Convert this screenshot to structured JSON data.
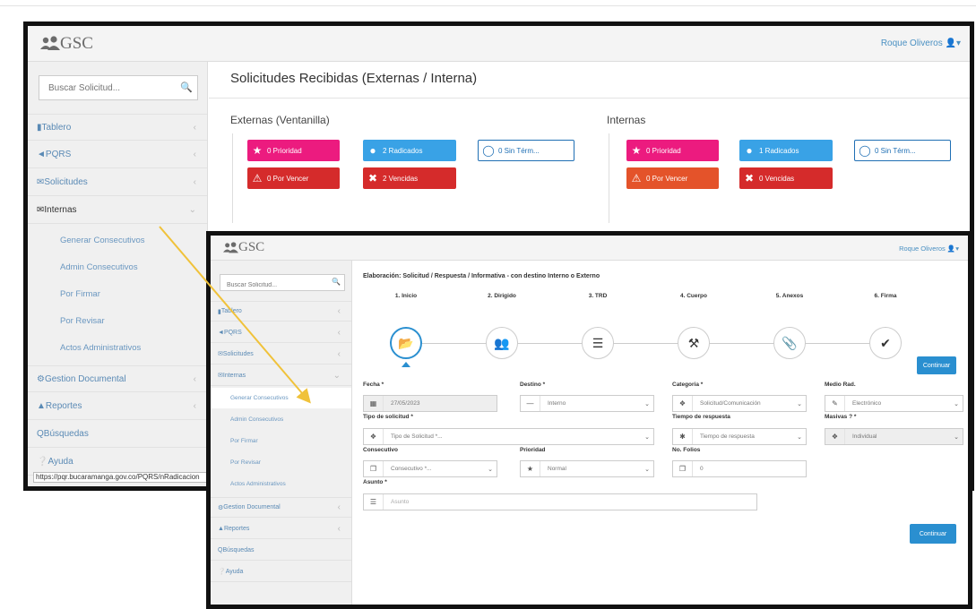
{
  "back_window": {
    "brand": "GSC",
    "user": "Roque Oliveros",
    "search_placeholder": "Buscar Solicitud...",
    "nav": [
      {
        "label": "Tablero"
      },
      {
        "label": "PQRS"
      },
      {
        "label": "Solicitudes"
      },
      {
        "label": "Internas"
      }
    ],
    "subnav": [
      "Generar Consecutivos",
      "Admin Consecutivos",
      "Por Firmar",
      "Por Revisar",
      "Actos Administrativos"
    ],
    "nav_bottom": [
      {
        "label": "Gestion Documental"
      },
      {
        "label": "Reportes"
      },
      {
        "label": "Búsquedas"
      },
      {
        "label": "Ayuda"
      }
    ],
    "status_url": "https://pqr.bucaramanga.gov.co/PQRS/nRadicacion",
    "page_title": "Solicitudes Recibidas (Externas / Interna)",
    "externas": {
      "title": "Externas (Ventanilla)",
      "tiles": {
        "prioridad": "0 Prioridad",
        "radicados": "2 Radicados",
        "sin_term": "0 Sin Térm...",
        "por_vencer": "0 Por Vencer",
        "vencidas": "2 Vencidas"
      }
    },
    "internas": {
      "title": "Internas",
      "tiles": {
        "prioridad": "0 Prioridad",
        "radicados": "1 Radicados",
        "sin_term": "0 Sin Térm...",
        "por_vencer": "0 Por Vencer",
        "vencidas": "0 Vencidas"
      }
    }
  },
  "front_window": {
    "brand": "GSC",
    "user": "Roque Oliveros",
    "search_placeholder": "Buscar Solicitud...",
    "nav": [
      {
        "label": "Tablero"
      },
      {
        "label": "PQRS"
      },
      {
        "label": "Solicitudes"
      },
      {
        "label": "Internas"
      }
    ],
    "subnav": [
      "Generar Consecutivos",
      "Admin Consecutivos",
      "Por Firmar",
      "Por Revisar",
      "Actos Administrativos"
    ],
    "nav_bottom": [
      {
        "label": "Gestion Documental"
      },
      {
        "label": "Reportes"
      },
      {
        "label": "Búsquedas"
      },
      {
        "label": "Ayuda"
      }
    ],
    "form_title": "Elaboración: Solicitud / Respuesta / Informativa - con destino Interno o Externo",
    "steps": [
      {
        "label": "1. Inicio",
        "icon": "folder-open-icon"
      },
      {
        "label": "2. Dirigido",
        "icon": "users-icon"
      },
      {
        "label": "3. TRD",
        "icon": "list-icon"
      },
      {
        "label": "4. Cuerpo",
        "icon": "wrench-icon"
      },
      {
        "label": "5. Anexos",
        "icon": "paperclip-icon"
      },
      {
        "label": "6. Firma",
        "icon": "check-icon"
      }
    ],
    "continuar_label": "Continuar",
    "fields": {
      "fecha": {
        "label": "Fecha *",
        "value": "27/05/2023"
      },
      "destino": {
        "label": "Destino *",
        "value": "Interno"
      },
      "categoria": {
        "label": "Categoria *",
        "value": "Solicitud/Comunicación"
      },
      "medio": {
        "label": "Medio Rad.",
        "value": "Electrónico"
      },
      "tipo": {
        "label": "Tipo de solicitud *",
        "value": "Tipo de Solicitud *..."
      },
      "tiempo": {
        "label": "Tiempo de respuesta",
        "value": "Tiempo de respuesta"
      },
      "masivas": {
        "label": "Masivas ? *",
        "value": "Individual"
      },
      "consecutivo": {
        "label": "Consecutivo",
        "value": "Consecutivo *..."
      },
      "prioridad": {
        "label": "Prioridad",
        "value": "Normal"
      },
      "folios": {
        "label": "No. Folios",
        "value": "0"
      },
      "asunto": {
        "label": "Asunto *",
        "placeholder": "Asunto"
      }
    }
  },
  "colors": {
    "pink": "#ec1b7f",
    "blue": "#39a2e6",
    "red": "#d52b2b",
    "orange": "#e4532a",
    "accent": "#2a8fd0",
    "arrow": "#f0c23a"
  }
}
